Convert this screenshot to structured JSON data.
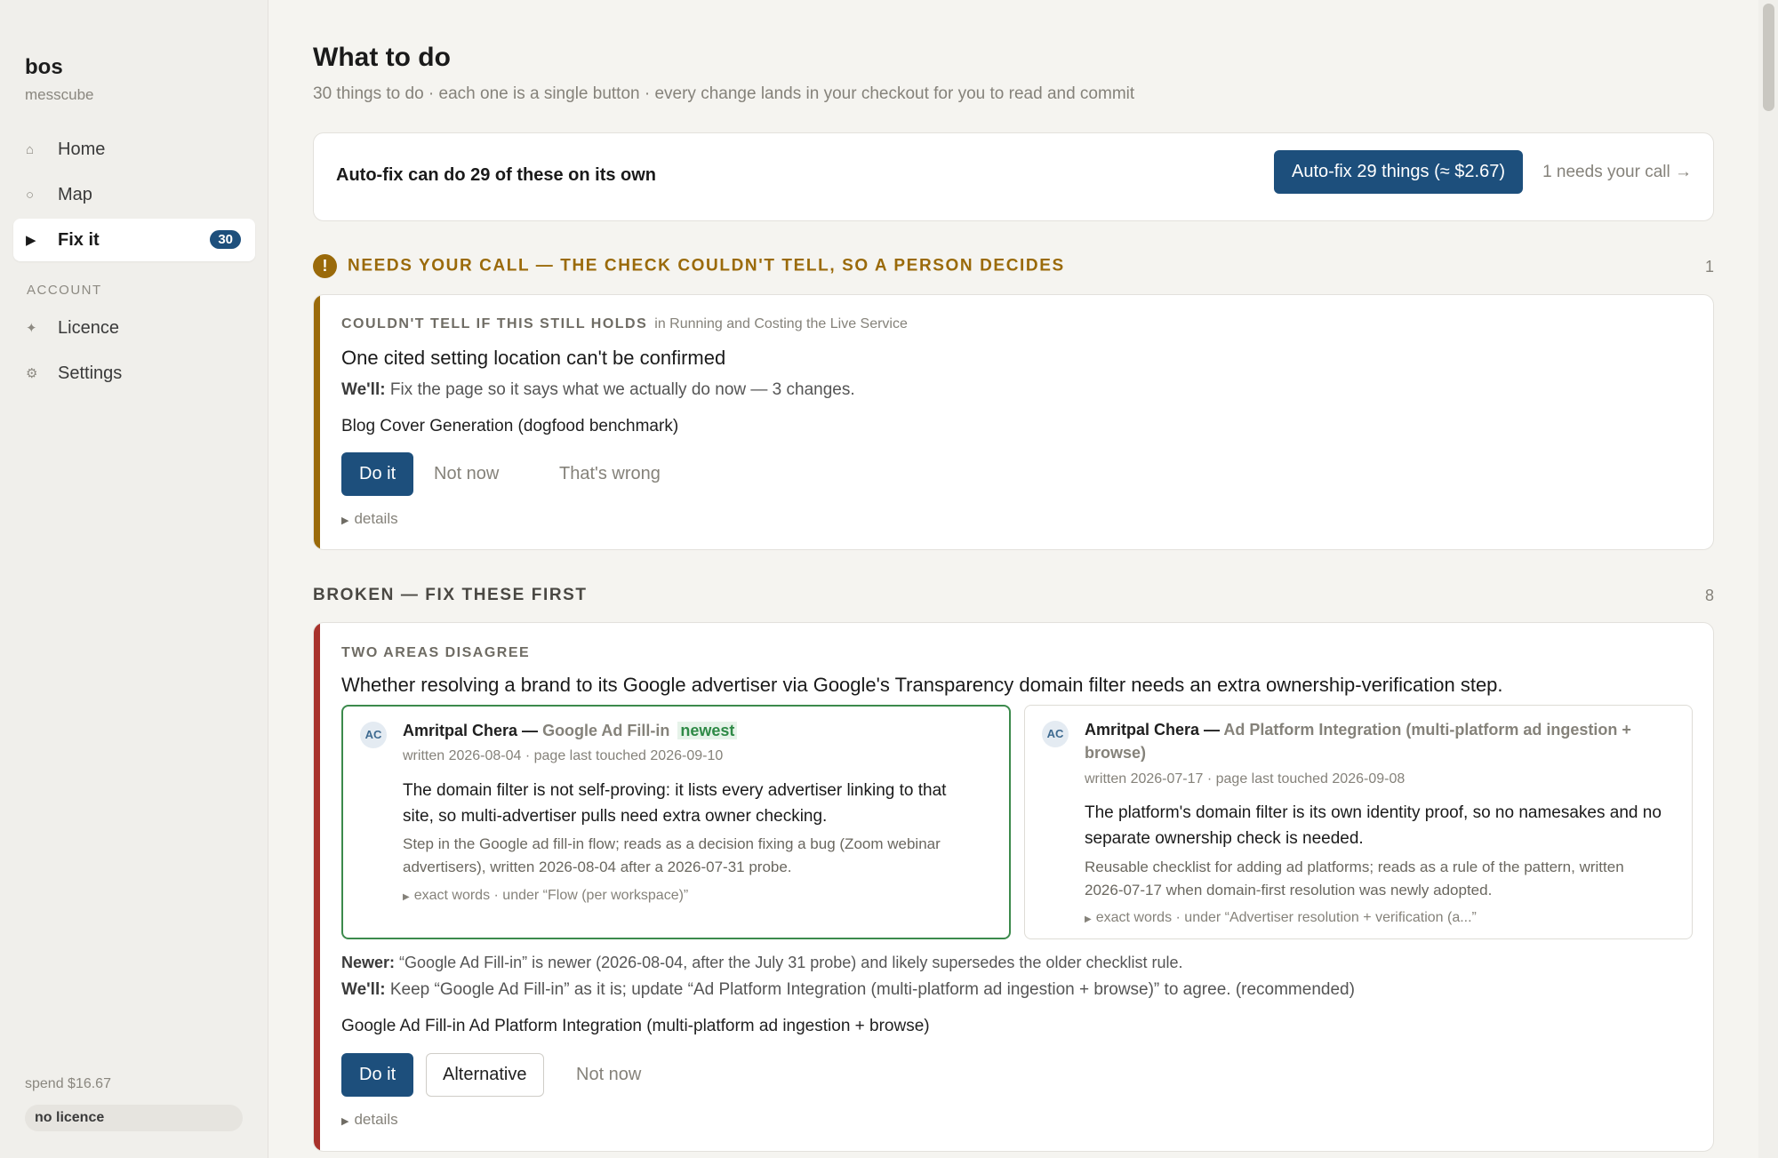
{
  "sidebar": {
    "brand": "bos",
    "workspace": "messcube",
    "nav": [
      {
        "label": "Home",
        "icon": "⌂"
      },
      {
        "label": "Map",
        "icon": "○"
      },
      {
        "label": "Fix it",
        "icon": "▶",
        "badge": "30"
      }
    ],
    "account_label": "ACCOUNT",
    "account_nav": [
      {
        "label": "Licence",
        "icon": "✦"
      },
      {
        "label": "Settings",
        "icon": "⚙"
      }
    ],
    "spend": "spend $16.67",
    "licence_status": "no licence"
  },
  "header": {
    "title": "What to do",
    "subtitle": "30 things to do · each one is a single button · every change lands in your checkout for you to read and commit"
  },
  "autofix": {
    "text": "Auto-fix can do 29 of these on its own",
    "button": "Auto-fix 29 things (≈ $2.67)",
    "needs_link": "1 needs your call →"
  },
  "needs_call": {
    "icon": "!",
    "heading": "NEEDS YOUR CALL — THE CHECK COULDN'T TELL, SO A PERSON DECIDES",
    "count": "1",
    "card": {
      "kicker": "COULDN'T TELL IF THIS STILL HOLDS",
      "where": "in Running and Costing the Live Service",
      "title": "One cited setting location can't be confirmed",
      "well_label": "We'll:",
      "well_text": "Fix the page so it says what we actually do now — 3 changes.",
      "page": "Blog Cover Generation (dogfood benchmark)",
      "do_it": "Do it",
      "not_now": "Not now",
      "wrong": "That's wrong",
      "details": "details"
    }
  },
  "broken": {
    "heading": "BROKEN — FIX THESE FIRST",
    "count": "8",
    "card": {
      "kicker": "TWO AREAS DISAGREE",
      "title": "Whether resolving a brand to its Google advertiser via Google's Transparency domain filter needs an extra ownership-verification step.",
      "left": {
        "avatar": "AC",
        "author": "Amritpal Chera —",
        "page": "Google Ad Fill-in",
        "tag": "newest",
        "meta": "written 2026-08-04 · page last touched 2026-09-10",
        "claim": "The domain filter is not self-proving: it lists every advertiser linking to that site, so multi-advertiser pulls need extra owner checking.",
        "note": "Step in the Google ad fill-in flow; reads as a decision fixing a bug (Zoom webinar advertisers), written 2026-08-04 after a 2026-07-31 probe.",
        "exact": "exact words · under “Flow (per workspace)”"
      },
      "right": {
        "avatar": "AC",
        "author": "Amritpal Chera —",
        "page": "Ad Platform Integration (multi-platform ad ingestion + browse)",
        "meta": "written 2026-07-17 · page last touched 2026-09-08",
        "claim": "The platform's domain filter is its own identity proof, so no namesakes and no separate ownership check is needed.",
        "note": "Reusable checklist for adding ad platforms; reads as a rule of the pattern, written 2026-07-17 when domain-first resolution was newly adopted.",
        "exact": "exact words · under “Advertiser resolution + verification (a...”"
      },
      "newer_label": "Newer:",
      "newer_text": "“Google Ad Fill-in” is newer (2026-08-04, after the July 31 probe) and likely supersedes the older checklist rule.",
      "well_label": "We'll:",
      "well_text": "Keep “Google Ad Fill-in” as it is; update “Ad Platform Integration (multi-platform ad ingestion + browse)” to agree. (recommended)",
      "pages": "Google Ad Fill-in  Ad Platform Integration (multi-platform ad ingestion + browse)",
      "do_it": "Do it",
      "alternative": "Alternative",
      "not_now": "Not now",
      "details": "details"
    }
  },
  "colors": {
    "accent": "#1d4f7c",
    "warning": "#9a6a0a",
    "danger": "#a8322c",
    "newest_border": "#3c8a4c"
  }
}
